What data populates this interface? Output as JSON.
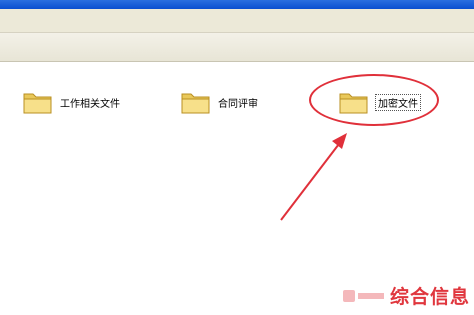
{
  "window": {
    "title_bar_color": "#0a4fcf",
    "toolbar_color": "#ece9d8"
  },
  "folders": [
    {
      "label": "工作相关文件",
      "icon": "folder-icon",
      "selected": false
    },
    {
      "label": "合同评审",
      "icon": "folder-icon",
      "selected": false
    },
    {
      "label": "加密文件",
      "icon": "folder-icon",
      "selected": true
    }
  ],
  "annotation": {
    "shape": "ellipse-and-arrow",
    "color": "#e0303a",
    "target": "加密文件"
  },
  "watermark": {
    "text": "综合信息",
    "color": "#e0373e"
  }
}
